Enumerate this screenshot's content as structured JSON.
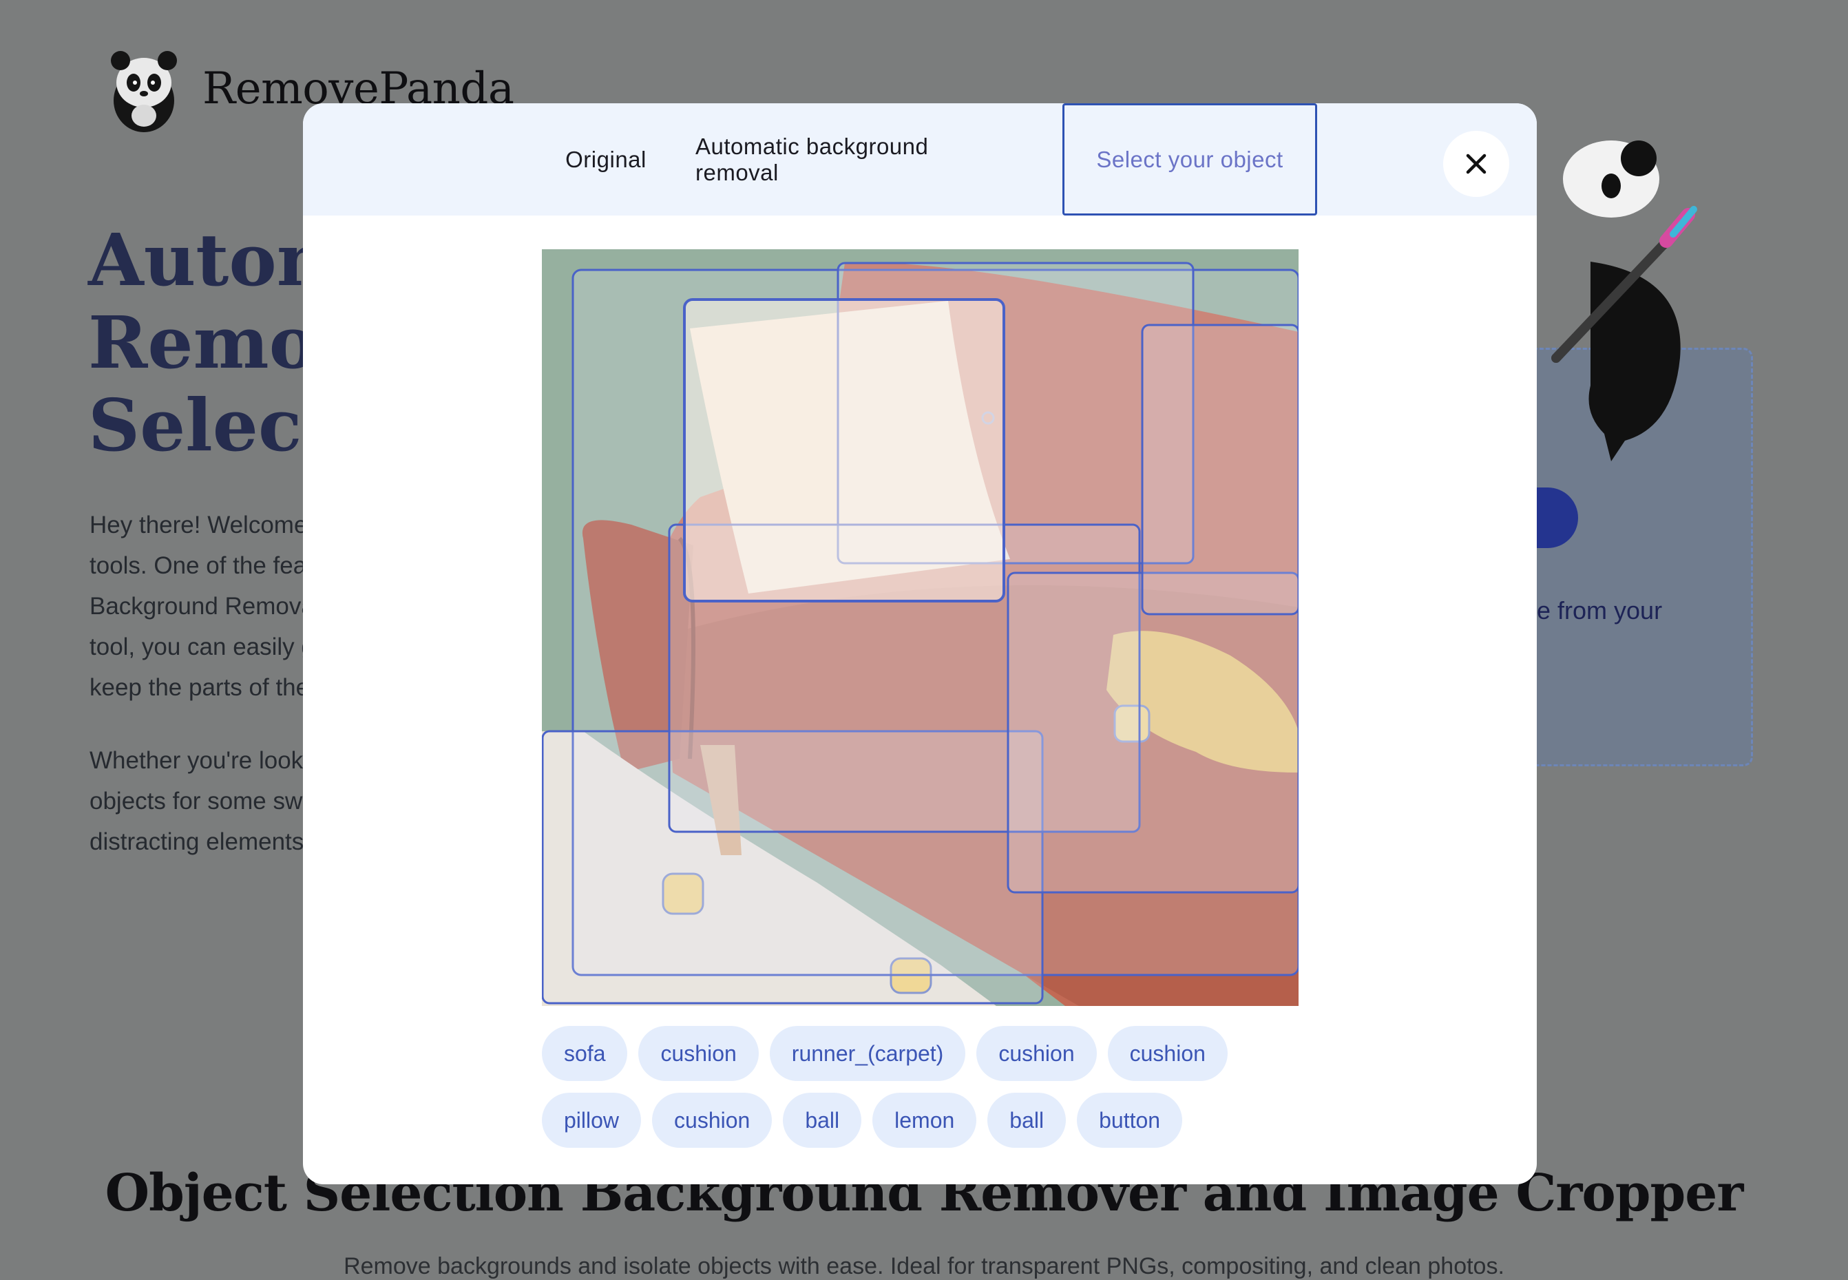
{
  "brand": {
    "name": "RemovePanda"
  },
  "hero": {
    "title_lines": [
      "Automa",
      "Remova",
      "Selectio"
    ],
    "para1_lines": [
      "Hey there! Welcome",
      "tools. One of the feat",
      "Background Remova",
      "tool, you can easily g",
      "keep the parts of the"
    ],
    "para2_lines": [
      "Whether you're look",
      "objects for some swe",
      "distracting elements"
    ]
  },
  "upload": {
    "text": "e from your"
  },
  "section": {
    "title": "Object Selection Background Remover and Image Cropper",
    "subtitle": "Remove backgrounds and isolate objects with ease. Ideal for transparent PNGs, compositing, and clean photos."
  },
  "modal": {
    "tabs": [
      {
        "label": "Original",
        "active": false
      },
      {
        "label": "Automatic background removal",
        "active": false
      },
      {
        "label": "Select your object",
        "active": true
      }
    ],
    "close_icon": "close-x-icon",
    "active_color": "#2e52b3",
    "chips_row1": [
      "sofa",
      "cushion",
      "runner_(carpet)",
      "cushion",
      "cushion"
    ],
    "chips_row2": [
      "pillow",
      "cushion",
      "ball",
      "lemon",
      "ball",
      "button"
    ]
  },
  "colors": {
    "overlay": "#7b7d7d",
    "header_bg": "#eef4fd",
    "chip_bg": "#e4edfc",
    "chip_text": "#3b55b5",
    "box_stroke": "#4a62c8"
  }
}
